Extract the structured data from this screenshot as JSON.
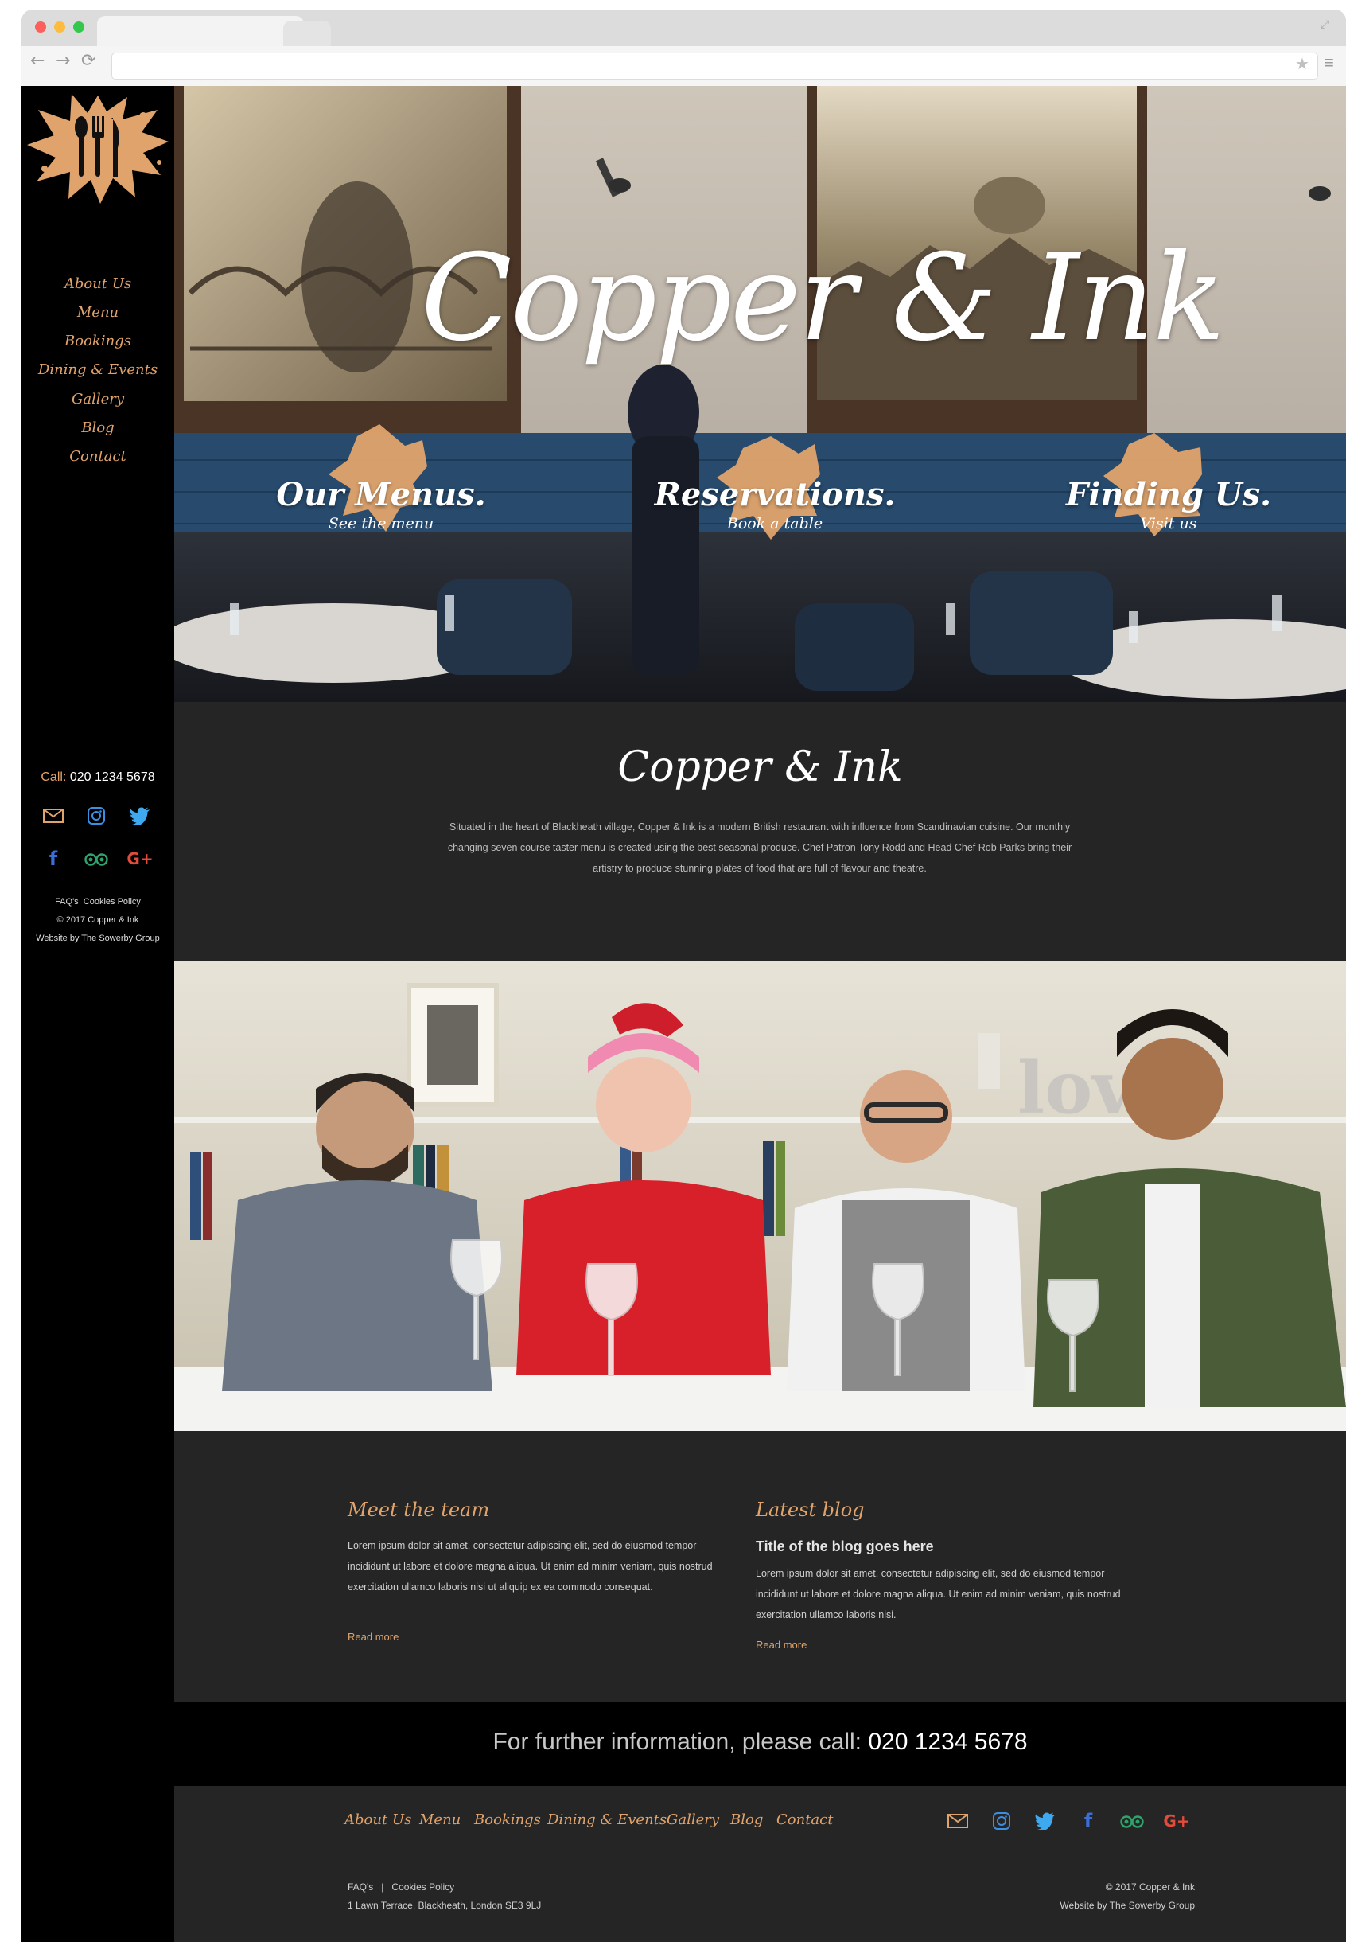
{
  "browser": {
    "nav": [
      "←",
      "→",
      "⟳"
    ],
    "icons": [
      "star-icon",
      "menu-icon",
      "fullscreen-icon"
    ]
  },
  "brand": {
    "name": "Copper & Ink",
    "accent": "#e0a36b"
  },
  "sidebar": {
    "nav": [
      "About Us",
      "Menu",
      "Bookings",
      "Dining & Events",
      "Gallery",
      "Blog",
      "Contact"
    ],
    "call_label": "Call:",
    "call_number": "020 1234 5678",
    "icons_row1": [
      "mail-icon",
      "instagram-icon",
      "twitter-icon"
    ],
    "icons_row2": [
      "facebook-icon",
      "tripadvisor-icon",
      "google-plus-icon"
    ],
    "faq": "FAQ's",
    "cookies": "Cookies Policy",
    "copyright": "© 2017 Copper & Ink",
    "credit": "Website by The Sowerby Group"
  },
  "hero": {
    "title": "Copper & Ink",
    "ctas": [
      {
        "title": "Our Menus.",
        "subtitle": "See the menu"
      },
      {
        "title": "Reservations.",
        "subtitle": "Book a table"
      },
      {
        "title": "Finding Us.",
        "subtitle": "Visit us"
      }
    ]
  },
  "intro": {
    "title": "Copper & Ink",
    "text": "Situated in the heart of Blackheath village, Copper & Ink is a modern British restaurant with influence from Scandinavian cuisine.  Our monthly changing seven course taster menu is created using the best seasonal produce.  Chef Patron Tony Rodd and Head Chef Rob Parks bring their artistry to produce stunning plates of food that are full of flavour and theatre."
  },
  "team_col": {
    "title": "Meet the team",
    "text": "Lorem ipsum dolor sit amet, consectetur adipiscing elit, sed do eiusmod tempor incididunt ut labore et dolore magna aliqua. Ut enim ad minim veniam, quis nostrud exercitation ullamco laboris nisi ut aliquip ex ea commodo consequat.",
    "read_more": "Read more"
  },
  "blog_col": {
    "title": "Latest blog",
    "post_title": "Title of the blog goes here",
    "text": "Lorem ipsum dolor sit amet, consectetur adipiscing elit, sed do eiusmod tempor incididunt ut labore et dolore magna aliqua. Ut enim ad minim veniam, quis nostrud exercitation ullamco laboris nisi.",
    "read_more": "Read more"
  },
  "callbar": {
    "text": "For further information, please call:",
    "number": "020 1234 5678"
  },
  "footer": {
    "nav": [
      "About Us",
      "Menu",
      "Bookings",
      "Dining & Events",
      "Gallery",
      "Blog",
      "Contact"
    ],
    "icons": [
      "mail-icon",
      "instagram-icon",
      "twitter-icon",
      "facebook-icon",
      "tripadvisor-icon",
      "google-plus-icon"
    ],
    "faq": "FAQ's",
    "cookies": "Cookies Policy",
    "address": "1 Lawn Terrace, Blackheath, London SE3 9LJ",
    "copyright": "© 2017 Copper & Ink",
    "credit": "Website by The Sowerby Group"
  }
}
